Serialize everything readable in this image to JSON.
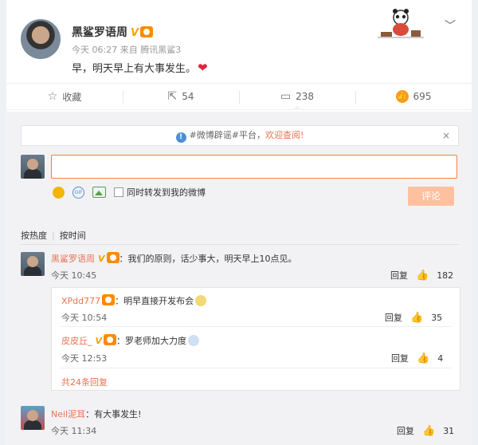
{
  "post": {
    "username": "黑鲨罗语周",
    "verified_badge": "V",
    "time": "今天 06:27",
    "source": "来自 腾讯黑鲨3",
    "text": "早，明天早上有大事发生。",
    "heart": "❤"
  },
  "actions": [
    {
      "label": "收藏",
      "icon": "star-icon"
    },
    {
      "label": "54",
      "icon": "share-icon"
    },
    {
      "label": "238",
      "icon": "comment-icon"
    },
    {
      "label": "695",
      "icon": "thumb-up-icon"
    }
  ],
  "comments_area": {
    "notice_prefix": "#微博辟谣#平台，",
    "notice_welcome": "欢迎查阅!",
    "close": "×",
    "forward_label": "同时转发到我的微博",
    "submit_label": "评论",
    "sort_hot": "按热度",
    "sort_time": "按时间"
  },
  "comments": [
    {
      "name": "黑鲨罗语周",
      "badge": "V",
      "text": "：我们的原则，话少事大，明天早上10点见。",
      "time": "今天 10:45",
      "reply": "回复",
      "likes": "182"
    },
    {
      "name": "Neil泥耳",
      "text": "：有大事发生!",
      "time": "今天 11:34",
      "reply": "回复",
      "likes": "31"
    }
  ],
  "sub_comments": [
    {
      "name": "XPdd777",
      "text": "：明早直接开发布会",
      "time": "今天 10:54",
      "reply": "回复",
      "likes": "35"
    },
    {
      "name": "皮皮丘_",
      "badge": "V",
      "text": "：罗老师加大力度",
      "time": "今天 12:53",
      "reply": "回复",
      "likes": "4"
    }
  ],
  "more_replies": "共24条回复"
}
